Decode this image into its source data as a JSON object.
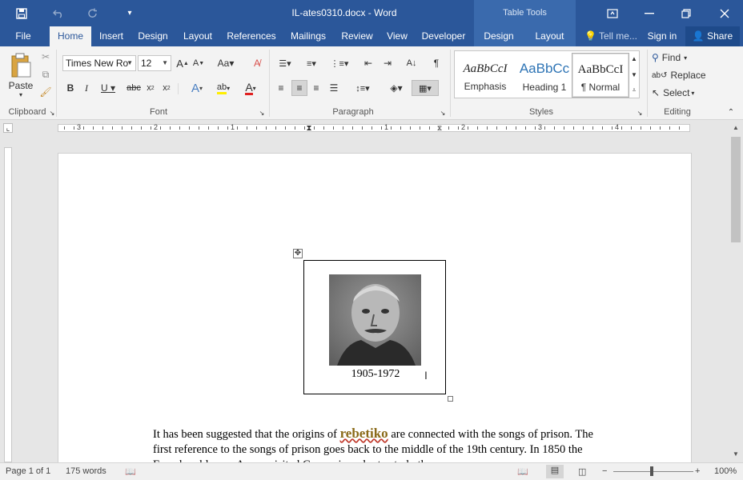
{
  "app": {
    "document_title": "IL-ates0310.docx - Word",
    "context_title": "Table Tools"
  },
  "tabs": [
    {
      "label": "File"
    },
    {
      "label": "Home"
    },
    {
      "label": "Insert"
    },
    {
      "label": "Design"
    },
    {
      "label": "Layout"
    },
    {
      "label": "References"
    },
    {
      "label": "Mailings"
    },
    {
      "label": "Review"
    },
    {
      "label": "View"
    },
    {
      "label": "Developer"
    },
    {
      "label": "Design"
    },
    {
      "label": "Layout"
    }
  ],
  "tell_me": "Tell me...",
  "sign_in": "Sign in",
  "share": "Share",
  "ribbon": {
    "clipboard": {
      "paste": "Paste",
      "label": "Clipboard"
    },
    "font": {
      "font_name": "Times New Ro",
      "font_size": "12",
      "label": "Font"
    },
    "paragraph": {
      "label": "Paragraph"
    },
    "styles": {
      "label": "Styles",
      "items": [
        {
          "preview": "AaBbCcI",
          "name": "Emphasis"
        },
        {
          "preview": "AaBbCc",
          "name": "Heading 1"
        },
        {
          "preview": "AaBbCcI",
          "name": "¶ Normal"
        }
      ]
    },
    "editing": {
      "find": "Find",
      "replace": "Replace",
      "select": "Select",
      "label": "Editing"
    }
  },
  "ruler": {
    "numbers": [
      "3",
      "2",
      "1",
      "1",
      "2",
      "3",
      "4"
    ]
  },
  "document": {
    "caption": "1905-1972",
    "paragraph_before": "It has been suggested that the origins of",
    "keyword": "rebetiko",
    "paragraph_after": "are connected with the songs of prison. The first reference to the songs of prison goes back to the middle of the 19th century. In 1850 the French nobleman Appor visited Greece in order to study the"
  },
  "status": {
    "page": "Page 1 of 1",
    "words": "175 words",
    "zoom": "100%"
  },
  "colors": {
    "accent": "#2b579a",
    "ribbon_bg": "#f3f3f3"
  }
}
